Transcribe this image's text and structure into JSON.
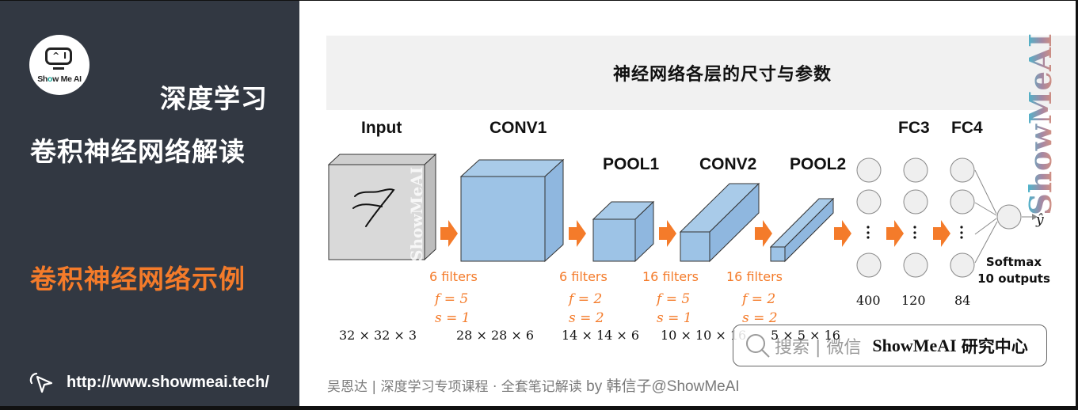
{
  "sidebar": {
    "logo_text_left": "Sh",
    "logo_text_eye": "o",
    "logo_text_right": "w Me AI",
    "course_title": "深度学习",
    "chapter_title": "卷积神经网络解读",
    "section_title": "卷积神经网络示例",
    "link_icon": "cursor-click-icon",
    "link_url": "http://www.showmeai.tech/"
  },
  "main": {
    "header_title": "神经网络各层的尺寸与参数",
    "side_watermark": "ShowMeAI",
    "input_watermark": "ShowMeAI",
    "input_digit": "7",
    "layers": [
      {
        "label": "Input",
        "dims": "32 × 32 × 3"
      },
      {
        "label": "CONV1",
        "filters": "6 filters",
        "f": "f = 5",
        "s": "s = 1",
        "dims": "28 × 28 × 6"
      },
      {
        "label": "POOL1",
        "filters": "6 filters",
        "f": "f = 2",
        "s": "s = 2",
        "dims": "14 × 14 × 6"
      },
      {
        "label": "CONV2",
        "filters": "16 filters",
        "f": "f = 5",
        "s": "s = 1",
        "dims": "10 × 10 × 16"
      },
      {
        "label": "POOL2",
        "filters": "16 filters",
        "f": "f = 2",
        "s": "s = 2",
        "dims": "5 × 5 × 16"
      }
    ],
    "fc_layers": [
      {
        "label": "",
        "count": "400"
      },
      {
        "label": "FC3",
        "count": "120"
      },
      {
        "label": "FC4",
        "count": "84"
      }
    ],
    "ellipsis": "⋮",
    "output_label": "ŷ",
    "softmax_line1": "Softmax",
    "softmax_line2": "10 outputs",
    "colors": {
      "accent_orange": "#f47b2a",
      "cube_blue": "#9dc3e6",
      "input_gray": "#d9d9d9",
      "sidebar_bg": "#323842"
    }
  },
  "search_box": {
    "icon": "search-icon",
    "hint": "搜索 | 微信",
    "brand": "ShowMeAI",
    "brand_suffix": "研究中心"
  },
  "footer": {
    "credit": "吴恩达 | 深度学习专项课程 · 全套笔记解读",
    "by": "by 韩信子@ShowMeAI"
  }
}
